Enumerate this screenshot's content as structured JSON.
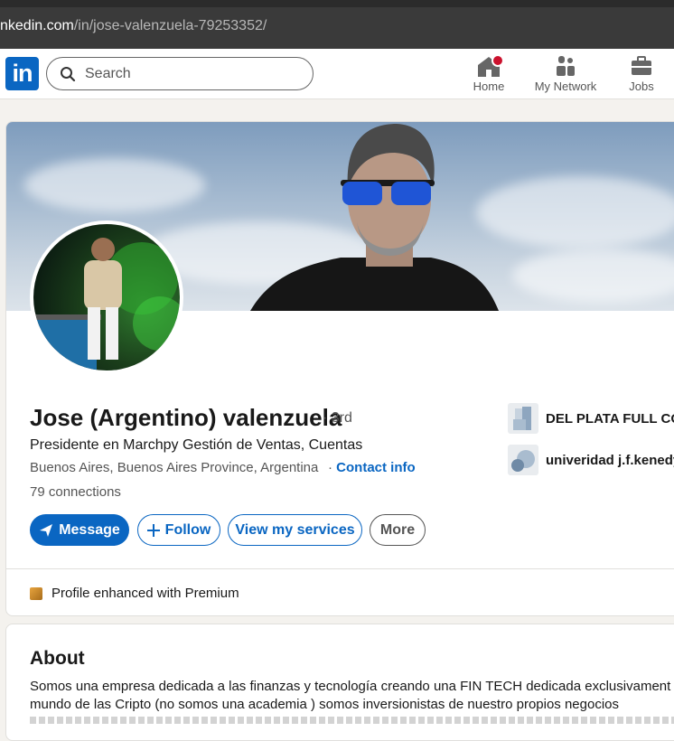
{
  "browser": {
    "url_prefix": "nkedin.com",
    "url_path": "/in/jose-valenzuela-79253352/"
  },
  "nav": {
    "logo_text": "in",
    "search_placeholder": "Search",
    "items": [
      {
        "label": "Home"
      },
      {
        "label": "My Network"
      },
      {
        "label": "Jobs"
      }
    ]
  },
  "profile": {
    "name": "Jose (Argentino) valenzuela",
    "degree": "· 3rd",
    "headline": "Presidente en Marchpy Gestión de Ventas, Cuentas",
    "location": "Buenos Aires, Buenos Aires Province, Argentina",
    "contact_sep": "·",
    "contact_label": "Contact info",
    "connections": "79 connections"
  },
  "actions": {
    "message": "Message",
    "follow": "Follow",
    "services": "View my services",
    "more": "More"
  },
  "experience": [
    {
      "label": "DEL PLATA FULL CO"
    },
    {
      "label": "univeridad j.f.kenedy"
    }
  ],
  "premium": {
    "label": "Profile enhanced with Premium"
  },
  "about": {
    "title": "About",
    "lines": [
      "Somos una empresa dedicada a las finanzas y tecnología creando una FIN TECH dedicada exclusivament",
      "mundo de las Cripto (no somos una academia ) somos inversionistas de nuestro propios negocios"
    ]
  },
  "colors": {
    "brand": "#0a66c2",
    "notification": "#cb112d",
    "premium": "#e7a33e"
  }
}
